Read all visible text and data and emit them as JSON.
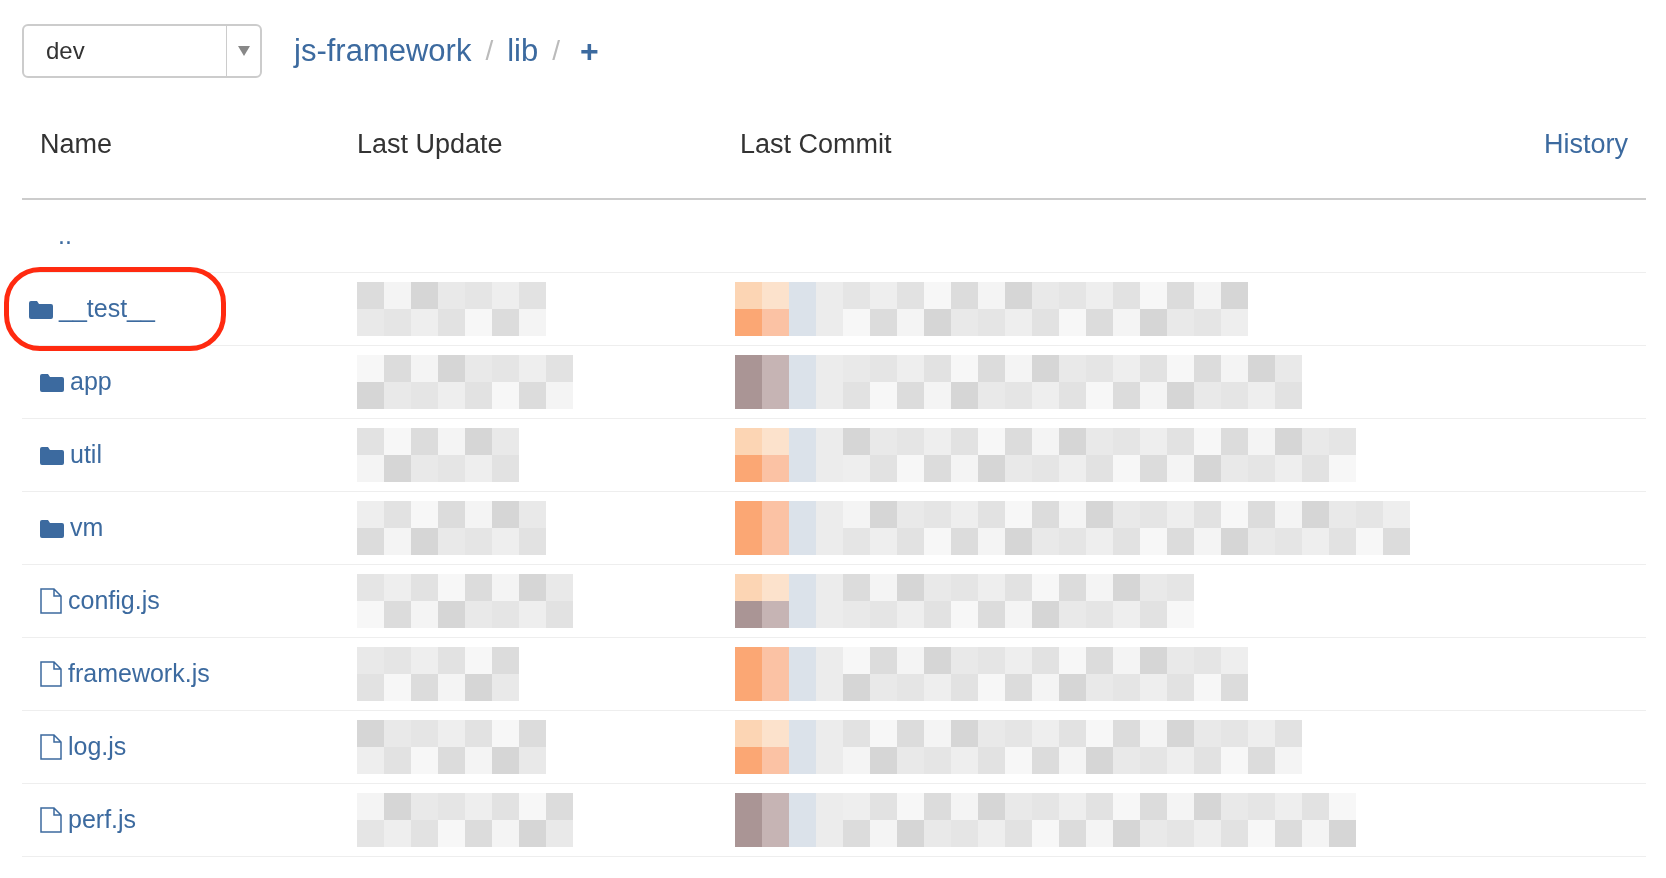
{
  "branch_select": {
    "value": "dev"
  },
  "breadcrumb": [
    {
      "label": "js-framework"
    },
    {
      "label": "lib"
    }
  ],
  "breadcrumb_separators": [
    "/",
    "/"
  ],
  "add_button": {
    "label": "+"
  },
  "table": {
    "columns": [
      "Name",
      "Last Update",
      "Last Commit"
    ],
    "history_link": "History",
    "rows": [
      {
        "kind": "parent",
        "name": "..",
        "highlighted": false
      },
      {
        "kind": "folder",
        "name": "__test__",
        "highlighted": true
      },
      {
        "kind": "folder",
        "name": "app",
        "highlighted": false
      },
      {
        "kind": "folder",
        "name": "util",
        "highlighted": false
      },
      {
        "kind": "folder",
        "name": "vm",
        "highlighted": false
      },
      {
        "kind": "file",
        "name": "config.js",
        "highlighted": false
      },
      {
        "kind": "file",
        "name": "framework.js",
        "highlighted": false
      },
      {
        "kind": "file",
        "name": "log.js",
        "highlighted": false
      },
      {
        "kind": "file",
        "name": "perf.js",
        "highlighted": false
      }
    ]
  }
}
